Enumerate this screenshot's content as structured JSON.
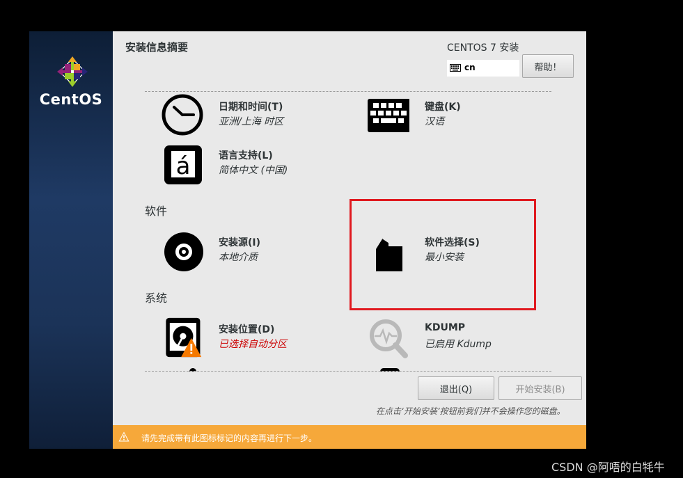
{
  "sidebar": {
    "brand": "CentOS"
  },
  "header": {
    "title": "安装信息摘要",
    "product_title": "CENTOS 7 安装",
    "keyboard_layout": "cn",
    "help_label": "帮助！"
  },
  "sections": {
    "software": "软件",
    "system": "系统"
  },
  "spokes": {
    "datetime": {
      "name": "日期和时间(T)",
      "status": "亚洲/上海 时区",
      "icon": "clock-icon"
    },
    "keyboard": {
      "name": "键盘(K)",
      "status": "汉语",
      "icon": "keyboard-icon"
    },
    "language": {
      "name": "语言支持(L)",
      "status": "简体中文 (中国)",
      "icon": "language-icon"
    },
    "source": {
      "name": "安装源(I)",
      "status": "本地介质",
      "icon": "disc-icon"
    },
    "software": {
      "name": "软件选择(S)",
      "status": "最小安装",
      "icon": "package-icon"
    },
    "destination": {
      "name": "安装位置(D)",
      "status": "已选择自动分区",
      "icon": "harddisk-warning-icon"
    },
    "kdump": {
      "name": "KDUMP",
      "status": "已启用 Kdump",
      "icon": "magnifier-icon"
    }
  },
  "footer": {
    "quit_label": "退出(Q)",
    "begin_label": "开始安装(B)",
    "note": "在点击‘开始安装’按钮前我们并不会操作您的磁盘。",
    "warning": "请先完成带有此图标标记的内容再进行下一步。"
  },
  "watermark": "CSDN @阿唔的白牦牛",
  "colors": {
    "sidebar": "#1f3a64",
    "warning_bar": "#f6a83a",
    "highlight": "#e0191f",
    "warn_text": "#cc0000"
  }
}
